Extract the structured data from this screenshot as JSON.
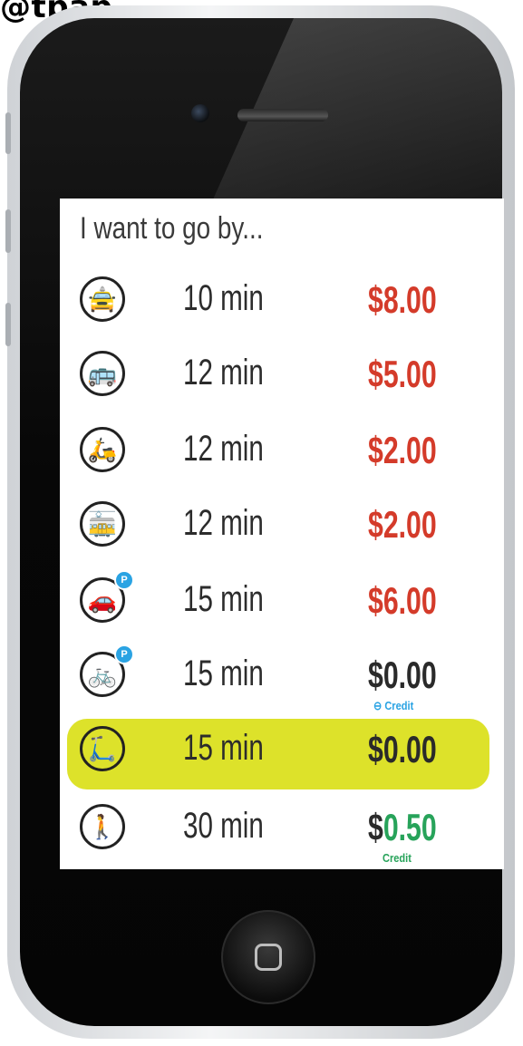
{
  "watermark": "@tpap_",
  "screen": {
    "heading": "I want to go by...",
    "rows": [
      {
        "icon": "taxi-icon",
        "time": "10 min",
        "price": "$8.00",
        "price_color": "#d43b2a",
        "badge": false,
        "credit": ""
      },
      {
        "icon": "bus-icon",
        "time": "12 min",
        "price": "$5.00",
        "price_color": "#d43b2a",
        "badge": false,
        "credit": ""
      },
      {
        "icon": "scooter-icon",
        "time": "12 min",
        "price": "$2.00",
        "price_color": "#d43b2a",
        "badge": false,
        "credit": ""
      },
      {
        "icon": "tram-icon",
        "time": "12 min",
        "price": "$2.00",
        "price_color": "#d43b2a",
        "badge": false,
        "credit": ""
      },
      {
        "icon": "car-parking-icon",
        "time": "15 min",
        "price": "$6.00",
        "price_color": "#d43b2a",
        "badge": true,
        "credit": ""
      },
      {
        "icon": "bicycle-parking-icon",
        "time": "15 min",
        "price": "$0.00",
        "price_color": "#2a2a2a",
        "badge": true,
        "credit": "⊖ Credit",
        "credit_color": "#2aa3e3"
      },
      {
        "icon": "cargo-bike-icon",
        "time": "15 min",
        "price": "$0.00",
        "price_color": "#2a2a2a",
        "badge": false,
        "credit": "",
        "highlight": true
      },
      {
        "icon": "walking-icon",
        "time": "30 min",
        "price_prefix": "$",
        "price_value": "0.50",
        "price_color": "#2a2a2a",
        "value_color": "#27a35a",
        "badge": false,
        "credit": "Credit",
        "credit_color": "#27a35a"
      }
    ]
  },
  "colors": {
    "highlight": "#dde22a",
    "cost_red": "#d43b2a",
    "credit_green": "#27a35a",
    "credit_blue": "#2aa3e3"
  }
}
